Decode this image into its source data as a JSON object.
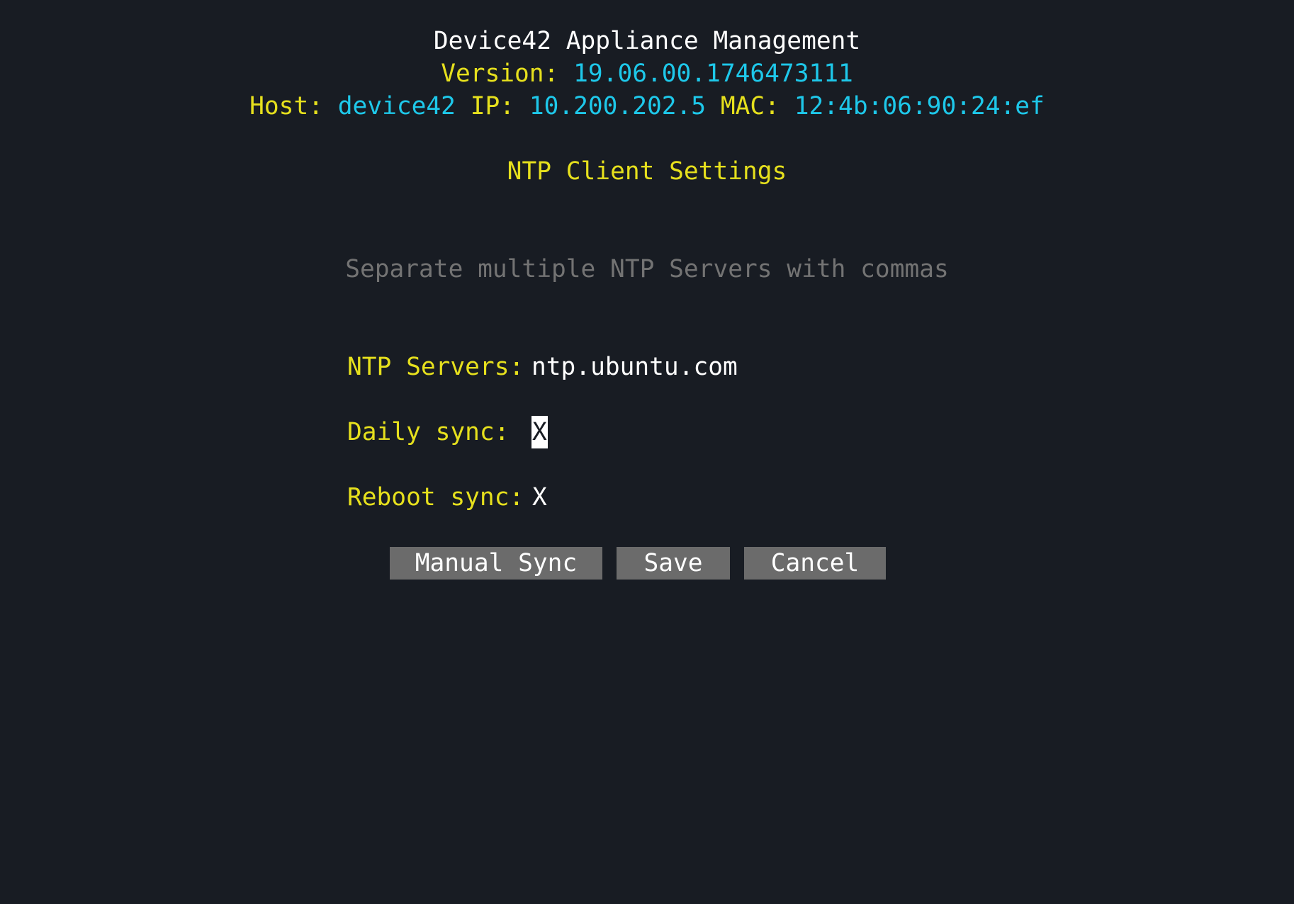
{
  "header": {
    "title": "Device42 Appliance Management",
    "version_label": "Version:",
    "version_value": "19.06.00.1746473111",
    "host_label": "Host:",
    "host_value": "device42",
    "ip_label": "IP:",
    "ip_value": "10.200.202.5",
    "mac_label": "MAC:",
    "mac_value": "12:4b:06:90:24:ef"
  },
  "page": {
    "title": "NTP Client Settings",
    "hint": "Separate multiple NTP Servers with commas"
  },
  "form": {
    "ntp_servers_label": "NTP Servers:",
    "ntp_servers_value": "ntp.ubuntu.com",
    "daily_sync_label": "Daily sync:",
    "daily_sync_value": "X",
    "reboot_sync_label": "Reboot sync:",
    "reboot_sync_value": "X"
  },
  "buttons": {
    "manual_sync": "Manual Sync",
    "save": "Save",
    "cancel": "Cancel"
  },
  "colors": {
    "background": "#181c23",
    "label": "#e6e01d",
    "value": "#1ec8ea",
    "text": "#ffffff",
    "hint": "#737373",
    "button": "#6b6b6b"
  }
}
